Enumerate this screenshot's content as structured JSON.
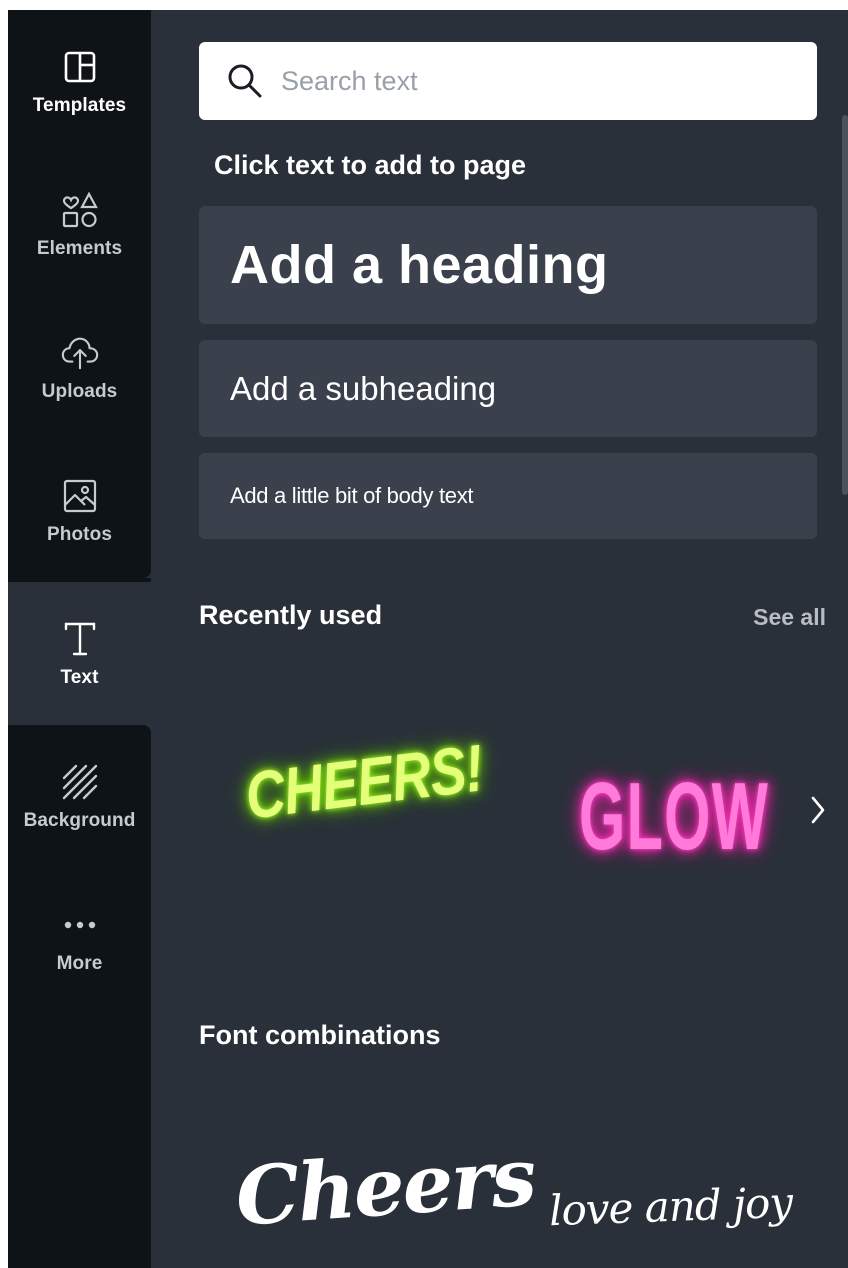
{
  "sidebar": {
    "items": [
      {
        "label": "Templates",
        "icon": "templates-icon"
      },
      {
        "label": "Elements",
        "icon": "elements-icon"
      },
      {
        "label": "Uploads",
        "icon": "upload-cloud-icon"
      },
      {
        "label": "Photos",
        "icon": "photo-icon"
      },
      {
        "label": "Text",
        "icon": "text-icon",
        "active": true
      },
      {
        "label": "Background",
        "icon": "background-icon"
      },
      {
        "label": "More",
        "icon": "more-dots-icon"
      }
    ]
  },
  "panel": {
    "search": {
      "placeholder": "Search text"
    },
    "click_hint": "Click text to add to page",
    "add_heading": "Add a heading",
    "add_subheading": "Add a subheading",
    "add_body": "Add a little bit of body text",
    "recently_used": {
      "title": "Recently used",
      "see_all": "See all",
      "presets": [
        "CHEERS!",
        "GLOW"
      ]
    },
    "font_combinations": {
      "title": "Font combinations",
      "presets": [
        "Cheers",
        "love and joy"
      ]
    }
  },
  "colors": {
    "sidebar_bg": "#0e1318",
    "panel_bg": "#293039",
    "button_bg": "#3a414c",
    "neon_green": "#c6ff4a",
    "neon_pink": "#ff5ccf"
  }
}
